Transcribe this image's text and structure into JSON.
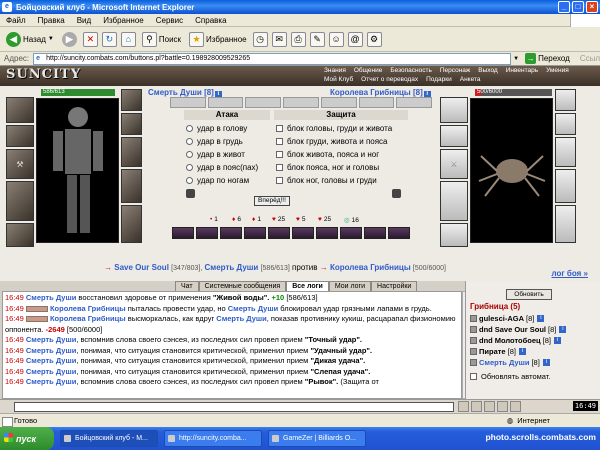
{
  "window": {
    "title": "Бойцовский клуб - Microsoft Internet Explorer"
  },
  "menu": [
    "Файл",
    "Правка",
    "Вид",
    "Избранное",
    "Сервис",
    "Справка"
  ],
  "toolbar": {
    "back": "Назад",
    "search": "Поиск",
    "favorites": "Избранное"
  },
  "address": {
    "label": "Адрес:",
    "url": "http://suncity.combats.com/buttons.pl?battle=0.198928009529265",
    "go": "Переход",
    "links": "Ссылки"
  },
  "game": {
    "logo": "SUNCITY",
    "nav": [
      "Знания",
      "Общение",
      "Безопасность",
      "Персонаж",
      "Выход",
      "Инвентарь",
      "Умения",
      "Мой Клуб",
      "Отчет о переводах",
      "Подарки",
      "Анкета"
    ],
    "left": {
      "name": "Смерть Души",
      "level": "[8]",
      "hp": "586/613",
      "hp_fraction": 0.956
    },
    "right": {
      "name": "Королева Грибницы",
      "level": "[8]",
      "hp": "500/6000",
      "hp_fraction": 0.083
    },
    "attack_header": "Атака",
    "defense_header": "Защита",
    "attacks": [
      "удар в голову",
      "удар в грудь",
      "удар в живот",
      "удар в пояс(пах)",
      "удар по ногам"
    ],
    "defenses": [
      "блок головы, груди и живота",
      "блок груди, живота и пояса",
      "блок живота, пояса и ног",
      "блок пояса, ног и головы",
      "блок ног, головы и груди"
    ],
    "forward": "Вперёд!!!",
    "stats": [
      {
        "icon": "•",
        "val": "1"
      },
      {
        "icon": "♦",
        "val": "6"
      },
      {
        "icon": "♦",
        "val": "1"
      },
      {
        "icon": "♥",
        "val": "25"
      },
      {
        "icon": "♥",
        "val": "5"
      },
      {
        "icon": "♥",
        "val": "25"
      },
      {
        "icon": "◎",
        "val": "16"
      }
    ],
    "pair": {
      "left_name": "Save Our Soul",
      "left_hp": "[347/803],",
      "mid_name": "Смерть Души",
      "mid_hp": "[586/613]",
      "vs": "против",
      "right_name": "Королева Грибницы",
      "right_hp": "[500/6000]"
    },
    "more": "лог боя »"
  },
  "chat": {
    "tabs": [
      "Чат",
      "Системные сообщения",
      "Все логи",
      "Мои логи",
      "Настройки"
    ],
    "active_tab": 2,
    "lines": [
      {
        "time": "16:49",
        "who": "Смерть Души",
        "text": "восстановил здоровье от применения",
        "bold": "\"Живой воды\".",
        "heal": "+10",
        "tail": "[586/613]"
      },
      {
        "time": "16:49",
        "who": "Королева Грибницы",
        "text": "пыталась провести удар, но",
        "who2": "Смерть Души",
        "text2": "блокировал удар грязными лапами в грудь."
      },
      {
        "time": "16:49",
        "who": "Королева Грибницы",
        "text": "высморкалась, как вдруг",
        "who2": "Смерть Души",
        "text2": ", показав противнику кукиш, расцарапал физиономию оппонента.",
        "dmg": "-2649",
        "tail": "[500/6000]"
      },
      {
        "time": "16:49",
        "who": "Смерть Души",
        "text": ", вспомнив слова своего сэнсея, из последних сил провел прием",
        "bold": "\"Точный удар\"."
      },
      {
        "time": "16:49",
        "who": "Смерть Души",
        "text": ", понимая, что ситуация становится критической, применил прием",
        "bold": "\"Удачный удар\"."
      },
      {
        "time": "16:49",
        "who": "Смерть Души",
        "text": ", понимая, что ситуация становится критической, применил прием",
        "bold": "\"Дикая удача\"."
      },
      {
        "time": "16:49",
        "who": "Смерть Души",
        "text": ", понимая, что ситуация становится критической, применил прием",
        "bold": "\"Слепая удача\"."
      },
      {
        "time": "16:49",
        "who": "Смерть Души",
        "text": ", вспомнив слова своего сэнсея, из последних сил провел прием",
        "bold": "\"Рывок\".",
        "tail": "(Защита от"
      }
    ]
  },
  "roster": {
    "refresh": "Обновить",
    "title": "Грибница (5)",
    "players": [
      {
        "name": "gulesci-AGA",
        "level": "[8]"
      },
      {
        "prefix": "dnd",
        "name": "Save Our Soul",
        "level": "[8]"
      },
      {
        "prefix": "dnd",
        "name": "Молотобоец",
        "level": "[8]"
      },
      {
        "name": "Пирате",
        "level": "[8]"
      },
      {
        "name": "Смерть Души",
        "level": "[8]",
        "me": true
      }
    ],
    "auto": "Обновлять автомат."
  },
  "clock": "16:49",
  "status": {
    "left": "Готово",
    "right": "Интернет"
  },
  "taskbar": {
    "start": "пуск",
    "tasks": [
      "Бойцовский клуб - M...",
      "http://suncity.comba...",
      "GameZer | Billiards O..."
    ],
    "watermark": "photo.scrolls.combats.com"
  }
}
